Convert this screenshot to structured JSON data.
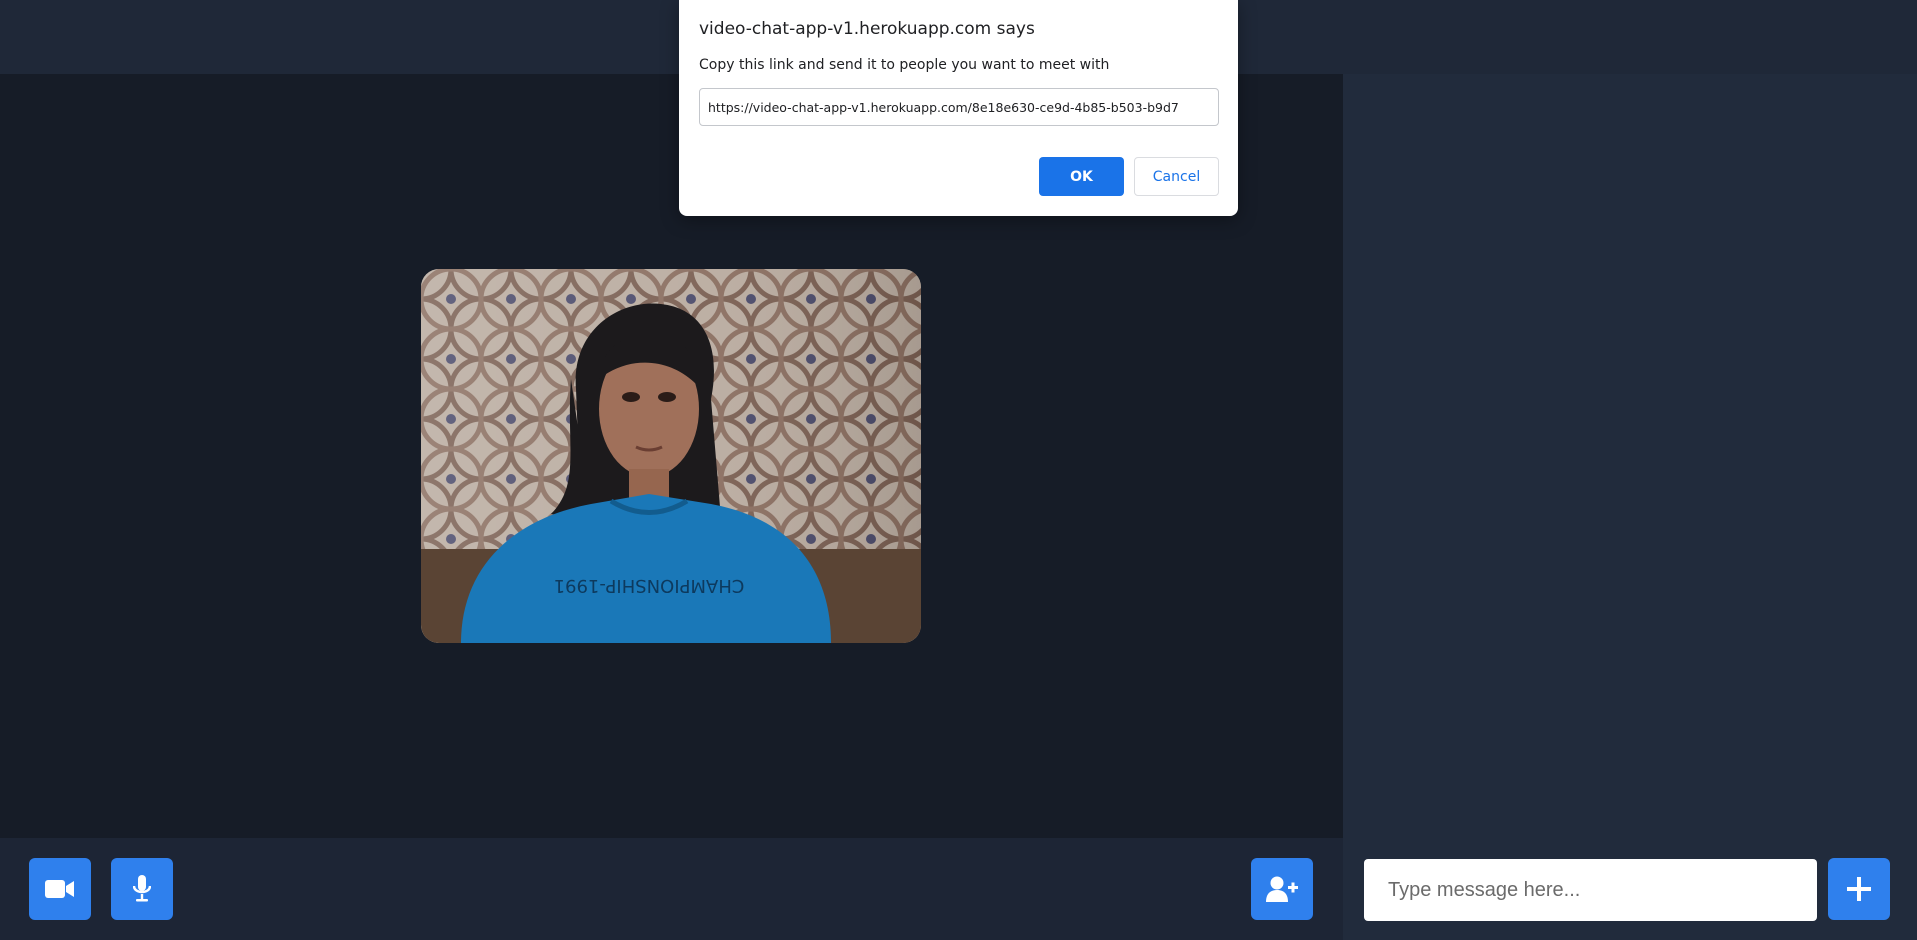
{
  "dialog": {
    "title": "video-chat-app-v1.herokuapp.com says",
    "message": "Copy this link and send it to people you want to meet with",
    "link_value": "https://video-chat-app-v1.herokuapp.com/8e18e630-ce9d-4b85-b503-b9d7",
    "ok_label": "OK",
    "cancel_label": "Cancel"
  },
  "video": {
    "shirt_text": "CHAMPIONSHIP-1991"
  },
  "controls": {
    "video_icon": "video-camera-icon",
    "mic_icon": "microphone-icon",
    "invite_icon": "user-plus-icon",
    "send_icon": "plus-icon"
  },
  "chat": {
    "input_placeholder": "Type message here..."
  },
  "colors": {
    "accent": "#2f80ed",
    "dialog_button": "#1a73e8",
    "background": "#161c27",
    "panel": "#212b3c"
  }
}
